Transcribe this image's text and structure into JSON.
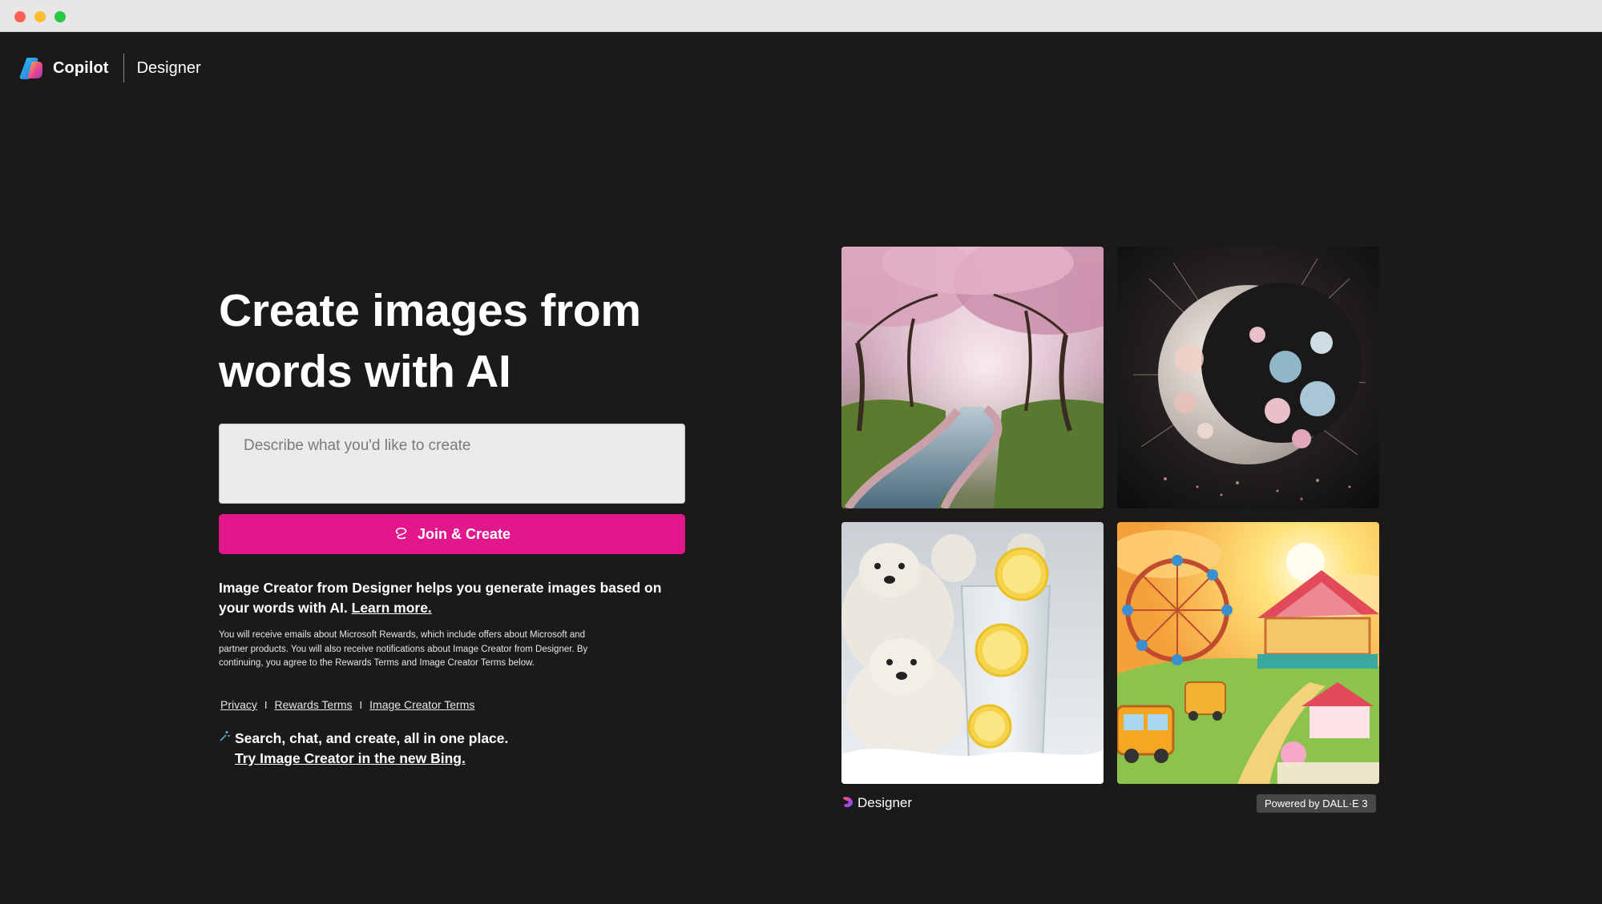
{
  "header": {
    "brand": "Copilot",
    "product": "Designer"
  },
  "hero": {
    "headline_line1": "Create images from",
    "headline_line2": "words with AI"
  },
  "prompt": {
    "placeholder": "Describe what you'd like to create",
    "value": ""
  },
  "cta": {
    "label": "Join & Create"
  },
  "description": {
    "text": "Image Creator from Designer helps you generate images based on your words with AI.",
    "link": "Learn more."
  },
  "fine_print": "You will receive emails about Microsoft Rewards, which include offers about Microsoft and partner products. You will also receive notifications about Image Creator from Designer. By continuing, you agree to the Rewards Terms and Image Creator Terms below.",
  "legal_links": {
    "privacy": "Privacy",
    "sep1": "I",
    "rewards_terms": "Rewards Terms",
    "sep2": "I",
    "image_creator_terms": "Image Creator Terms"
  },
  "bing": {
    "text": "Search, chat, and create, all in one place.",
    "link": "Try Image Creator in the new Bing."
  },
  "gallery": {
    "designer_label": "Designer",
    "powered_by": "Powered by DALL·E 3",
    "images": [
      {
        "name": "cherry-blossom-river"
      },
      {
        "name": "floral-crescent-moon"
      },
      {
        "name": "polar-bears-lemonade"
      },
      {
        "name": "cartoon-carnival"
      }
    ]
  },
  "colors": {
    "background": "#1b1a19",
    "accent": "#e3178c",
    "input_bg": "#ebebeb"
  }
}
